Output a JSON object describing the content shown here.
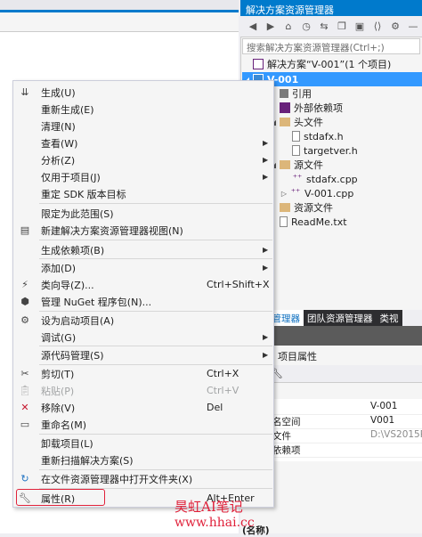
{
  "solution_explorer": {
    "title": "解决方案资源管理器",
    "search_placeholder": "搜索解决方案资源管理器(Ctrl+;)",
    "tree": {
      "solution": "解决方案“V-001”(1 个项目)",
      "project": "V-001",
      "references": "引用",
      "external_deps": "外部依赖项",
      "header_folder": "头文件",
      "stdafx_h": "stdafx.h",
      "targetver_h": "targetver.h",
      "source_folder": "源文件",
      "stdafx_cpp": "stdafx.cpp",
      "v001_cpp": "V-001.cpp",
      "resource_folder": "资源文件",
      "readme": "ReadMe.txt"
    }
  },
  "bottom_tabs": [
    "案资源管理器",
    "团队资源管理器",
    "类视"
  ],
  "properties": {
    "header": "项目属性",
    "rows": [
      {
        "key": "",
        "value": "V-001"
      },
      {
        "key": "名空间",
        "value": "V001"
      },
      {
        "key": "文件",
        "value": "D:\\VS2015Pr"
      },
      {
        "key": "依赖项",
        "value": ""
      }
    ],
    "desc_label": "(名称)"
  },
  "context_menu": {
    "items": [
      {
        "label": "生成(U)",
        "icon": "build-icon"
      },
      {
        "label": "重新生成(E)"
      },
      {
        "label": "清理(N)"
      },
      {
        "label": "查看(W)",
        "submenu": true
      },
      {
        "label": "分析(Z)",
        "submenu": true
      },
      {
        "label": "仅用于项目(J)",
        "submenu": true
      },
      {
        "label": "重定 SDK 版本目标"
      },
      {
        "label": "限定为此范围(S)"
      },
      {
        "label": "新建解决方案资源管理器视图(N)",
        "icon": "new-view-icon"
      },
      {
        "label": "生成依赖项(B)",
        "submenu": true
      },
      {
        "label": "添加(D)",
        "submenu": true
      },
      {
        "label": "类向导(Z)...",
        "shortcut": "Ctrl+Shift+X",
        "icon": "class-wizard-icon"
      },
      {
        "label": "管理 NuGet 程序包(N)...",
        "icon": "nuget-icon"
      },
      {
        "label": "设为启动项目(A)",
        "icon": "gear-icon"
      },
      {
        "label": "调试(G)",
        "submenu": true
      },
      {
        "label": "源代码管理(S)",
        "submenu": true
      },
      {
        "label": "剪切(T)",
        "shortcut": "Ctrl+X",
        "icon": "scissors-icon"
      },
      {
        "label": "粘贴(P)",
        "shortcut": "Ctrl+V",
        "disabled": true,
        "icon": "paste-icon"
      },
      {
        "label": "移除(V)",
        "shortcut": "Del",
        "icon": "close-icon"
      },
      {
        "label": "重命名(M)",
        "icon": "rename-icon"
      },
      {
        "label": "卸载项目(L)"
      },
      {
        "label": "重新扫描解决方案(S)"
      },
      {
        "label": "在文件资源管理器中打开文件夹(X)",
        "icon": "refresh-icon"
      },
      {
        "label": "属性(R)",
        "shortcut": "Alt+Enter",
        "icon": "wrench-icon"
      }
    ]
  },
  "watermark": {
    "line1": "昊虹AI笔记",
    "line2": "www.hhai.cc"
  },
  "colors": {
    "accent": "#007acc",
    "selection": "#3399ff",
    "highlight_box": "#e0213a"
  }
}
